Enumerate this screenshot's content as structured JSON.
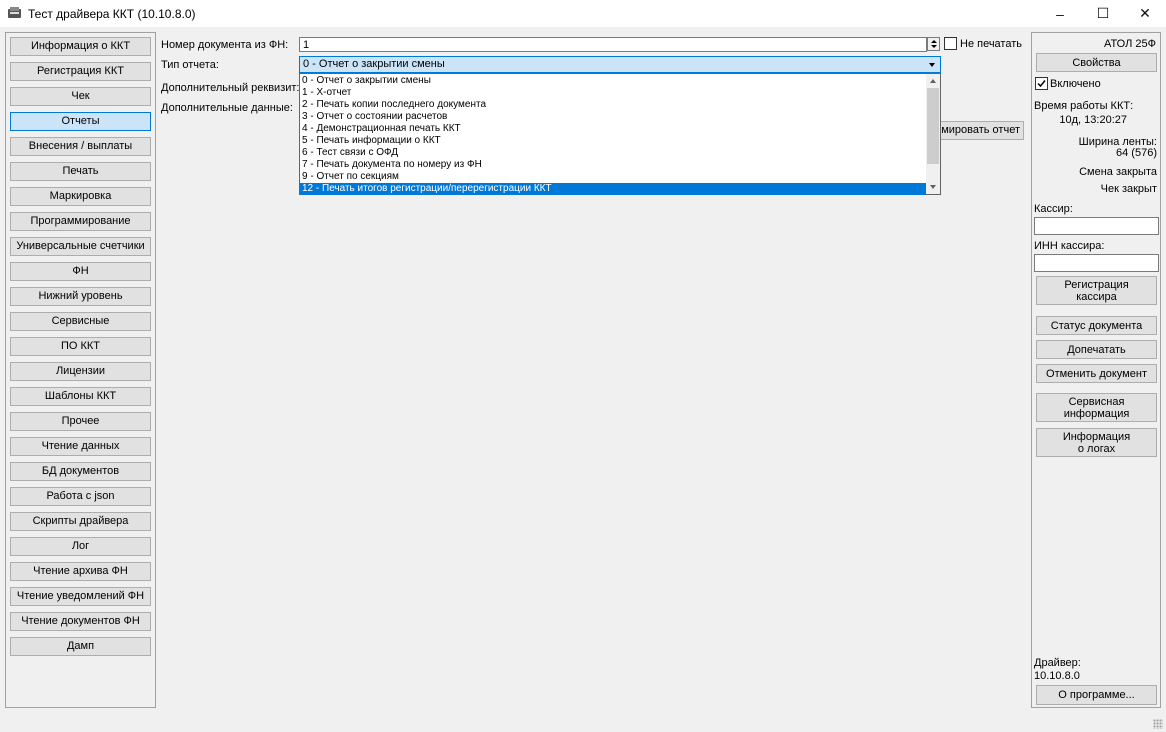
{
  "window": {
    "title": "Тест драйвера ККТ (10.10.8.0)",
    "minimize": "–",
    "maximize": "☐",
    "close": "✕"
  },
  "nav": {
    "items": [
      {
        "label": "Информация о ККТ"
      },
      {
        "label": "Регистрация ККТ"
      },
      {
        "label": "Чек"
      },
      {
        "label": "Отчеты",
        "active": true
      },
      {
        "label": "Внесения / выплаты"
      },
      {
        "label": "Печать"
      },
      {
        "label": "Маркировка"
      },
      {
        "label": "Программирование"
      },
      {
        "label": "Универсальные счетчики"
      },
      {
        "label": "ФН"
      },
      {
        "label": "Нижний уровень"
      },
      {
        "label": "Сервисные"
      },
      {
        "label": "ПО ККТ"
      },
      {
        "label": "Лицензии"
      },
      {
        "label": "Шаблоны ККТ"
      },
      {
        "label": "Прочее"
      },
      {
        "label": "Чтение данных"
      },
      {
        "label": "БД документов"
      },
      {
        "label": "Работа с json"
      },
      {
        "label": "Скрипты драйвера"
      },
      {
        "label": "Лог"
      },
      {
        "label": "Чтение архива ФН"
      },
      {
        "label": "Чтение уведомлений ФН"
      },
      {
        "label": "Чтение документов ФН"
      },
      {
        "label": "Дамп"
      }
    ]
  },
  "form": {
    "doc_number_label": "Номер документа из ФН:",
    "doc_number_value": "1",
    "no_print_label": "Не печатать",
    "no_print_checked": false,
    "report_type_label": "Тип отчета:",
    "report_type_value": "0 - Отчет о закрытии смены",
    "extra_req_label": "Дополнительный реквизит:",
    "extra_data_label": "Дополнительные данные:",
    "make_report_button": "рмировать отчет",
    "report_options": [
      "0 - Отчет о закрытии смены",
      "1 - X-отчет",
      "2 - Печать копии последнего документа",
      "3 - Отчет о состоянии расчетов",
      "4 - Демонстрационная печать ККТ",
      "5 - Печать информации о ККТ",
      "6 - Тест связи с ОФД",
      "7 - Печать документа по номеру из ФН",
      "9 - Отчет по секциям",
      "12 - Печать итогов регистрации/перерегистрации ККТ"
    ],
    "selected_option_index": 9
  },
  "right": {
    "model": "АТОЛ 25Ф",
    "properties_button": "Свойства",
    "enabled_label": "Включено",
    "enabled_checked": true,
    "uptime_label": "Время работы ККТ:",
    "uptime_value": "10д, 13:20:27",
    "tape_width_label": "Ширина ленты:",
    "tape_width_value": "64 (576)",
    "shift_status": "Смена закрыта",
    "receipt_status": "Чек закрыт",
    "cashier_label": "Кассир:",
    "cashier_value": "",
    "cashier_inn_label": "ИНН кассира:",
    "cashier_inn_value": "",
    "register_cashier_line1": "Регистрация",
    "register_cashier_line2": "кассира",
    "doc_status_button": "Статус документа",
    "reprint_button": "Допечатать",
    "cancel_doc_button": "Отменить документ",
    "service_info_line1": "Сервисная",
    "service_info_line2": "информация",
    "logs_info_line1": "Информация",
    "logs_info_line2": "о логах",
    "driver_label": "Драйвер:",
    "driver_version": "10.10.8.0",
    "about_button": "О программе..."
  }
}
